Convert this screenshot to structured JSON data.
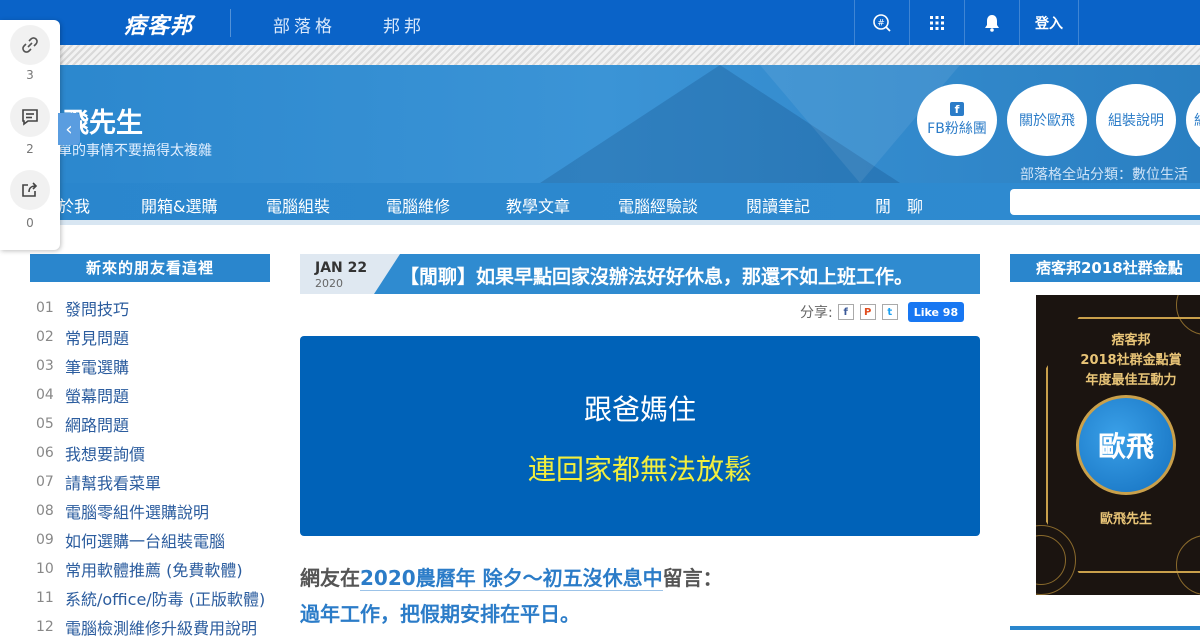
{
  "topbar": {
    "logo": "痞客邦",
    "nav": [
      "部落格",
      "邦邦"
    ],
    "icons": [
      "hashtag-search-icon",
      "grid-icon",
      "bell-icon"
    ],
    "login_label": "登入"
  },
  "floatbar": {
    "items": [
      {
        "icon": "link-icon",
        "count": "3"
      },
      {
        "icon": "comment-icon",
        "count": "2"
      },
      {
        "icon": "share-icon",
        "count": "0"
      }
    ],
    "collapse_glyph": "‹"
  },
  "blog": {
    "title": "飛先生",
    "subtitle": "單的事情不要搞得太複雜",
    "buttons": [
      "FB粉絲團",
      "關於歐飛",
      "組裝說明",
      "組"
    ],
    "category": "部落格全站分類：數位生活",
    "menu": [
      "於我",
      "開箱&選購",
      "電腦組裝",
      "電腦維修",
      "教學文章",
      "電腦經驗談",
      "閱讀筆記",
      "閒　聊"
    ]
  },
  "left_sidebar": {
    "heading": "新來的朋友看這裡",
    "items": [
      {
        "num": "01",
        "label": "發問技巧"
      },
      {
        "num": "02",
        "label": "常見問題"
      },
      {
        "num": "03",
        "label": "筆電選購"
      },
      {
        "num": "04",
        "label": "螢幕問題"
      },
      {
        "num": "05",
        "label": "網路問題"
      },
      {
        "num": "06",
        "label": "我想要詢價"
      },
      {
        "num": "07",
        "label": "請幫我看菜單"
      },
      {
        "num": "08",
        "label": "電腦零組件選購說明"
      },
      {
        "num": "09",
        "label": "如何選購一台組裝電腦"
      },
      {
        "num": "10",
        "label": "常用軟體推薦 (免費軟體)"
      },
      {
        "num": "11",
        "label": "系統/office/防毒 (正版軟體)"
      },
      {
        "num": "12",
        "label": "電腦檢測維修升級費用說明"
      }
    ]
  },
  "post": {
    "month_day": "JAN 22",
    "year": "2020",
    "title": "【閒聊】如果早點回家沒辦法好好休息，那還不如上班工作。",
    "share_label": "分享:",
    "like_label": "Like 98",
    "hero_line1": "跟爸媽住",
    "hero_line2": "連回家都無法放鬆",
    "body_prefix": "網友在",
    "body_link": "2020農曆年 除夕～初五沒休息中",
    "body_suffix": "留言：",
    "body_line2": "過年工作，把假期安排在平日。"
  },
  "right_sidebar": {
    "heading": "痞客邦2018社群金點",
    "award_line1": "痞客邦",
    "award_line2": "2018社群金點賞",
    "award_line3": "年度最佳互動力",
    "award_badge": "歐飛",
    "award_name": "歐飛先生"
  },
  "colors": {
    "topbar": "#0a63c8",
    "blog_blue": "#2a86cd",
    "hero": "#0062b8",
    "hero_highlight": "#f2ee3d"
  }
}
